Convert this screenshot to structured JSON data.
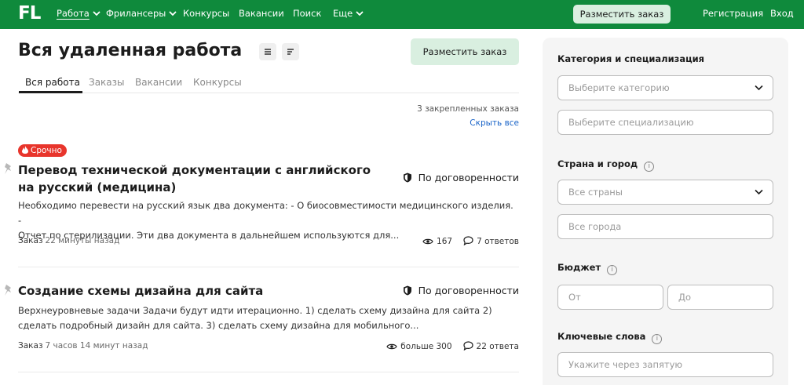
{
  "header": {
    "logo": "FL",
    "nav": [
      {
        "label": "Работа",
        "chevron": true,
        "active": true
      },
      {
        "label": "Фрилансеры",
        "chevron": true
      },
      {
        "label": "Конкурсы"
      },
      {
        "label": "Вакансии"
      },
      {
        "label": "Поиск"
      },
      {
        "label": "Еще",
        "chevron": true
      }
    ],
    "post_button": "Разместить заказ",
    "register": "Регистрация",
    "login": "Вход"
  },
  "main": {
    "title": "Вся удаленная работа",
    "post_button": "Разместить заказ",
    "tabs": [
      "Вся работа",
      "Заказы",
      "Вакансии",
      "Конкурсы"
    ],
    "pinned_count": "3 закрепленных заказа",
    "hide_all": "Скрыть все",
    "jobs": [
      {
        "badge": "Срочно",
        "title_line1": "Перевод технической документации с английского",
        "title_line2": "на русский (медицина)",
        "budget": "По договоренности",
        "desc_line1": "Необходимо перевести на русский язык два документа: - О биосовместимости медицинского изделия. -",
        "desc_line2": "Отчет по стерилизации.  Эти два документа в дальнейшем используются для...",
        "type": "Заказ",
        "time": "22 минуты назад",
        "views": "167",
        "answers": "7 ответов"
      },
      {
        "title_line1": "Создание схемы дизайна для сайта",
        "budget": "По договоренности",
        "desc_line1": "Верхнеуровневые задачи Задачи будут идти итерационно.   1) сделать схему дизайна для сайта 2)",
        "desc_line2": "сделать подробный дизайн для сайта. 3) сделать схему дизайна для мобильного...",
        "type": "Заказ",
        "time": "7 часов 14 минут назад",
        "views": "больше 300",
        "answers": "22 ответа"
      }
    ]
  },
  "sidebar": {
    "category_label": "Категория и специализация",
    "category_placeholder": "Выберите категорию",
    "specialization_placeholder": "Выберите специализацию",
    "location_label": "Страна и город",
    "country_placeholder": "Все страны",
    "city_placeholder": "Все города",
    "budget_label": "Бюджет",
    "budget_from": "От",
    "budget_to": "До",
    "keywords_label": "Ключевые слова",
    "keywords_placeholder": "Укажите через запятую"
  },
  "colors": {
    "header_bg": "#0f8a3c",
    "button_bg": "#d9efe0",
    "urgent": "#e8352c",
    "link": "#1a64c8",
    "sidebar_bg": "#f5f5f5"
  }
}
